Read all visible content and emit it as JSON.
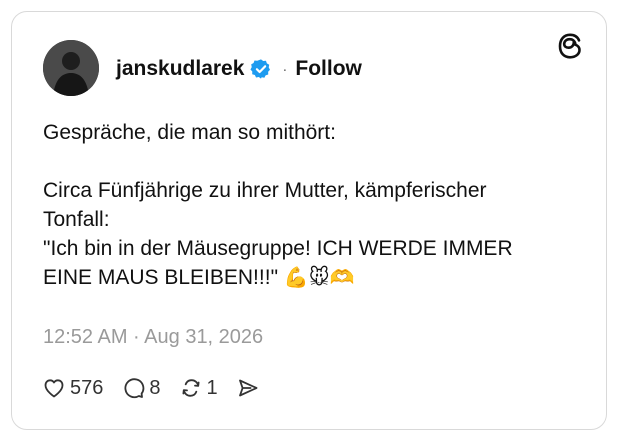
{
  "post": {
    "username": "janskudlarek",
    "follow_label": "Follow",
    "separator": "·",
    "lines": {
      "l1": "Gespräche, die man so mithört:",
      "l2": "Circa Fünfjährige zu ihrer Mutter, kämpferischer",
      "l3": "Tonfall:",
      "l4": "\"Ich bin in der Mäusegruppe! ICH WERDE IMMER",
      "l5": "EINE MAUS BLEIBEN!!!\"",
      "emojis": "💪🐭🫶"
    },
    "timestamp": "12:52 AM · Aug 31, 2026"
  },
  "actions": {
    "likes": "576",
    "replies": "8",
    "reposts": "1"
  },
  "icons": {
    "verified": "verified-badge-icon",
    "logo": "threads-logo-icon",
    "like": "heart-icon",
    "reply": "comment-icon",
    "repost": "repost-icon",
    "share": "share-icon"
  },
  "colors": {
    "verified": "#1d9bf0",
    "text": "#111111",
    "muted": "#9a9a9a",
    "border": "#d9d9d9"
  }
}
